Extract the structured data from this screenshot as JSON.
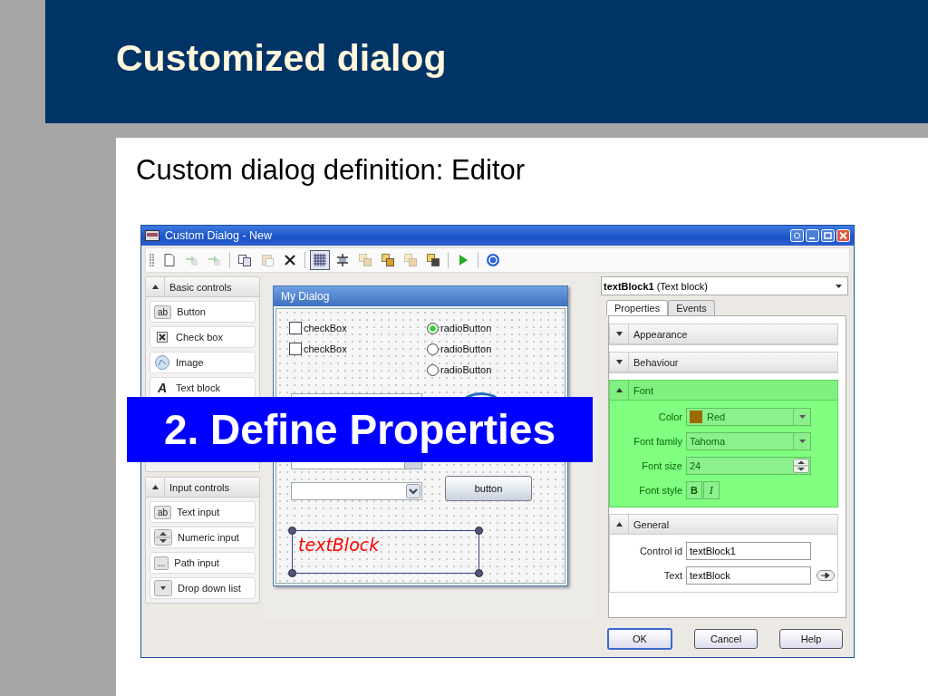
{
  "slide": {
    "title": "Customized dialog",
    "subtitle": "Custom dialog definition: Editor",
    "banner": "2. Define Properties"
  },
  "window": {
    "title": "Custom Dialog - New",
    "buttons": [
      {
        "kind": "pin"
      },
      {
        "kind": "minimize"
      },
      {
        "kind": "maximize"
      },
      {
        "kind": "close"
      }
    ]
  },
  "toolbar": [
    {
      "kind": "new",
      "disabled": false,
      "selected": false
    },
    {
      "kind": "import",
      "disabled": true,
      "selected": false
    },
    {
      "kind": "export",
      "disabled": true,
      "selected": false
    },
    {
      "kind": "separator"
    },
    {
      "kind": "copy",
      "disabled": false,
      "selected": false
    },
    {
      "kind": "paste",
      "disabled": true,
      "selected": false
    },
    {
      "kind": "delete",
      "disabled": false,
      "selected": false
    },
    {
      "kind": "separator"
    },
    {
      "kind": "grid",
      "disabled": false,
      "selected": true
    },
    {
      "kind": "align",
      "disabled": false,
      "selected": false
    },
    {
      "kind": "front",
      "disabled": true,
      "selected": false
    },
    {
      "kind": "layer",
      "disabled": false,
      "selected": false
    },
    {
      "kind": "back",
      "disabled": true,
      "selected": false
    },
    {
      "kind": "group",
      "disabled": false,
      "selected": false
    },
    {
      "kind": "separator"
    },
    {
      "kind": "run",
      "disabled": false,
      "selected": false
    },
    {
      "kind": "separator"
    },
    {
      "kind": "help",
      "disabled": false,
      "selected": false
    }
  ],
  "toolbox": [
    {
      "title": "Basic controls",
      "expanded": true,
      "items": [
        {
          "label": "Button",
          "kind": "button",
          "glyph": "ab"
        },
        {
          "label": "Check box",
          "kind": "checkbox"
        },
        {
          "label": "Image",
          "kind": "image"
        },
        {
          "label": "Text block",
          "kind": "text",
          "glyph": "A"
        }
      ]
    },
    {
      "title": "Input controls",
      "expanded": true,
      "items": [
        {
          "label": "Text input",
          "kind": "textinput",
          "glyph": "ab"
        },
        {
          "label": "Numeric input",
          "kind": "numeric"
        },
        {
          "label": "Path input",
          "kind": "path",
          "glyph": "..."
        },
        {
          "label": "Drop down list",
          "kind": "dropdown"
        }
      ]
    }
  ],
  "form": {
    "title": "My Dialog",
    "controls": [
      {
        "kind": "checkbox",
        "label": "checkBox",
        "checked": false
      },
      {
        "kind": "radio",
        "label": "radioButton",
        "selected": true
      },
      {
        "kind": "checkbox",
        "label": "checkBox",
        "checked": false
      },
      {
        "kind": "radio",
        "label": "radioButton",
        "selected": false
      },
      {
        "kind": "radio",
        "label": "radioButton",
        "selected": false
      },
      {
        "kind": "textfield"
      },
      {
        "kind": "image"
      },
      {
        "kind": "pathinput"
      },
      {
        "kind": "button",
        "label": "button"
      },
      {
        "kind": "dropdown"
      },
      {
        "kind": "textblock",
        "label": "textBlock",
        "selected": true
      }
    ]
  },
  "inspector": {
    "object": "**textBlock1** (Text block)",
    "tabs": [
      {
        "label": "Properties",
        "selected": true
      },
      {
        "label": "Events",
        "selected": false
      }
    ],
    "sections": [
      {
        "title": "Appearance",
        "expanded": false,
        "highlighted": false
      },
      {
        "title": "Behaviour",
        "expanded": false,
        "highlighted": false
      },
      {
        "title": "Font",
        "expanded": true,
        "highlighted": true,
        "rows": [
          {
            "label": "Color",
            "kind": "color",
            "value": "Red",
            "color": "#9a6a00"
          },
          {
            "label": "Font family",
            "kind": "dropdown",
            "value": "Tahoma"
          },
          {
            "label": "Font size",
            "kind": "spinner",
            "value": "24"
          },
          {
            "label": "Font style",
            "kind": "style",
            "buttons": [
              {
                "label": "B",
                "kind": "bold"
              },
              {
                "label": "I",
                "kind": "italic"
              }
            ]
          }
        ]
      },
      {
        "title": "General",
        "expanded": true,
        "highlighted": false,
        "rows": [
          {
            "label": "Control id",
            "kind": "text",
            "value": "textBlock1",
            "action": false
          },
          {
            "label": "Text",
            "kind": "text",
            "value": "textBlock",
            "action": true
          }
        ]
      }
    ]
  },
  "footer": [
    {
      "label": "OK",
      "default": true
    },
    {
      "label": "Cancel",
      "default": false
    },
    {
      "label": "Help",
      "default": false
    }
  ]
}
